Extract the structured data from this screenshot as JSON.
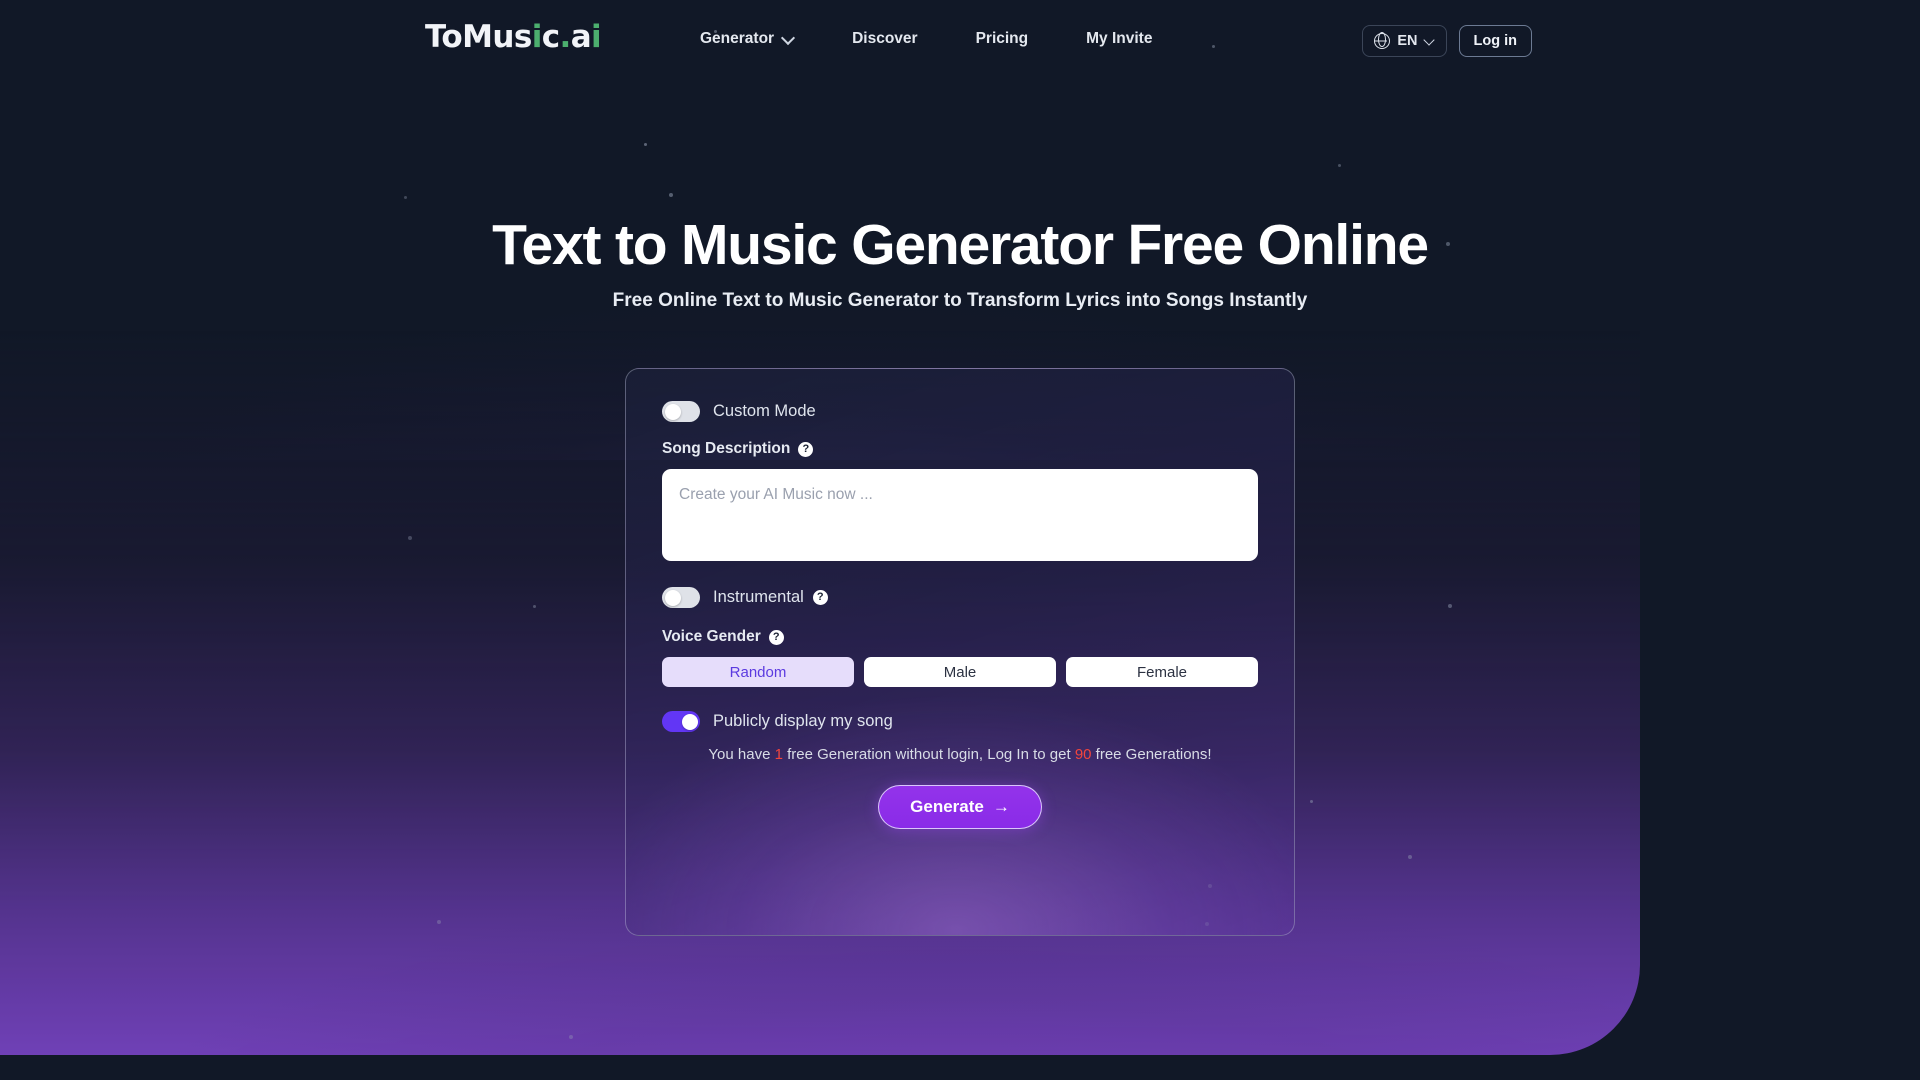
{
  "header": {
    "logo": {
      "prefix": "ToMus",
      "dot1": "i",
      "mid": "c",
      "dot2": ".",
      "suffix": "a",
      "dot3": "i",
      "full": "ToMusic.ai"
    },
    "nav": [
      {
        "label": "Generator",
        "has_chevron": true,
        "icon": "chevron-down-icon"
      },
      {
        "label": "Discover",
        "has_chevron": false
      },
      {
        "label": "Pricing",
        "has_chevron": false
      },
      {
        "label": "My Invite",
        "has_chevron": false
      }
    ],
    "language": {
      "code": "EN",
      "icon": "globe-icon",
      "chevron": "chevron-down-icon"
    },
    "login_label": "Log in"
  },
  "hero": {
    "title": "Text to Music Generator Free Online",
    "subtitle": "Free Online Text to Music Generator to Transform Lyrics into Songs Instantly"
  },
  "generator": {
    "custom_mode": {
      "label": "Custom Mode",
      "state": "off"
    },
    "song_description": {
      "label": "Song Description",
      "help_icon": "question-mark-icon",
      "placeholder": "Create your AI Music now ...",
      "value": ""
    },
    "instrumental": {
      "label": "Instrumental",
      "state": "off",
      "help_icon": "question-mark-icon"
    },
    "voice_gender": {
      "label": "Voice Gender",
      "help_icon": "question-mark-icon",
      "options": [
        "Random",
        "Male",
        "Female"
      ],
      "selected": "Random"
    },
    "publicly_display": {
      "label": "Publicly display my song",
      "state": "on"
    },
    "hint": {
      "part1": "You have ",
      "count_free": "1",
      "part2": " free Generation without login, Log In to get ",
      "count_login": "90",
      "part3": " free Generations!"
    },
    "generate_button": {
      "label": "Generate",
      "arrow": "→",
      "icon": "arrow-right-icon"
    }
  },
  "colors": {
    "page_background": "#111827",
    "accent_purple": "#9333ea",
    "toggle_on": "#6236f5",
    "segment_active_bg": "#e6ddfb",
    "segment_active_text": "#5b3ae0",
    "alert_red": "#f2453d",
    "logo_green": "#4caf6e"
  }
}
